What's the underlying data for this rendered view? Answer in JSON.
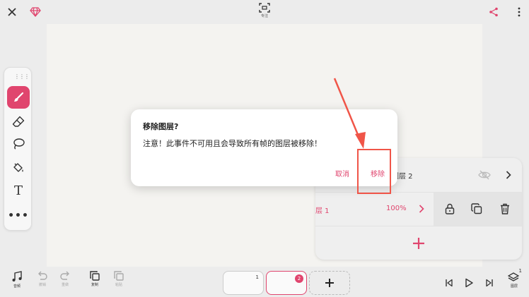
{
  "topbar": {
    "close_icon": "close-icon",
    "premium_icon": "diamond-icon",
    "focus_label": "专注",
    "share_icon": "share-icon",
    "more_icon": "more-vertical-icon"
  },
  "tools": {
    "items": [
      {
        "name": "brush",
        "icon": "brush-icon",
        "active": true
      },
      {
        "name": "eraser",
        "icon": "eraser-icon",
        "active": false
      },
      {
        "name": "lasso",
        "icon": "lasso-icon",
        "active": false
      },
      {
        "name": "fill",
        "icon": "paint-bucket-icon",
        "active": false
      },
      {
        "name": "text",
        "icon": "text-icon",
        "letter": "T",
        "active": false
      },
      {
        "name": "more",
        "icon": "more-horizontal-icon",
        "dots": "•••",
        "active": false
      }
    ]
  },
  "layers": {
    "layer2_name": "图层 2",
    "layer1_name": "图层 1",
    "layer1_name_visible": "层 1",
    "layer1_opacity": "100%",
    "add_label": "+"
  },
  "dialog": {
    "title": "移除图层?",
    "message": "注意！此事件不可用且会导致所有帧的图层被移除！",
    "cancel_label": "取消",
    "confirm_label": "移除"
  },
  "bottombar": {
    "sound_label": "音频",
    "undo_label": "撤销",
    "redo_label": "重做",
    "copy_label": "复制",
    "paste_label": "粘贴",
    "layers_label": "图层",
    "layers_count": "1"
  },
  "frames": [
    {
      "number": "1",
      "selected": false
    },
    {
      "number": "2",
      "selected": true
    }
  ],
  "colors": {
    "accent": "#e0456e",
    "annotation": "#f05548"
  }
}
